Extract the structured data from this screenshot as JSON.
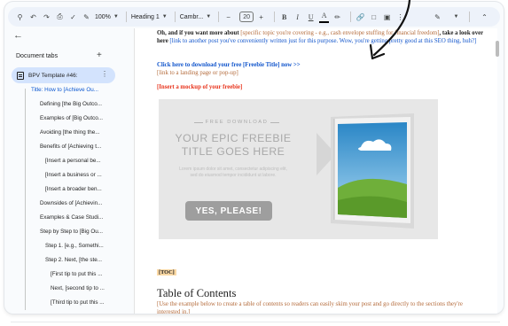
{
  "toolbar": {
    "zoom": "100%",
    "style": "Heading 1",
    "font": "Cambr...",
    "font_size": "20",
    "bold": "B",
    "italic": "I",
    "underline": "U",
    "text_color": "A",
    "minus": "−",
    "plus": "+"
  },
  "sidebar": {
    "title": "Document tabs",
    "add": "+",
    "tab_label": "BPV Template #46:",
    "outline": [
      "Title: How to [Achieve Ou...",
      "Defining [the Big Outco...",
      "Examples of [Big Outco...",
      "Avoiding [the thing the...",
      "Benefits of [Achieving t...",
      "[Insert a personal be...",
      "[Insert a business or ...",
      "[Insert a broader ben...",
      "Downsides of [Achievin...",
      "Examples & Case Studi...",
      "Step by Step to [Big Ou...",
      "Step 1. [e.g., Somethi...",
      "Step 2. Next, [the ste...",
      "[First tip to put this ...",
      "Next, [second tip to ...",
      "[Third tip to put this ..."
    ]
  },
  "doc": {
    "p1_a": "Oh, and if you want more about ",
    "p1_b": "[specific topic you're covering - e.g., cash envelope stuffing for financial freedom]",
    "p1_c": ", take a look over here ",
    "p1_d": "[link to another post you've conveniently written just for this purpose. Wow, you're getting pretty good at this SEO thing, huh?]",
    "cta_link": "Click here to download your free [Freebie Title] now >>",
    "cta_note": "[link to a landing page or pop-up]",
    "mockup_note": "[Insert a mockup of your freebie]",
    "toc_tag": "[TOC]",
    "toc_heading": "Table of Contents",
    "toc_note": "[Use the example below to create a table of contents so readers can easily skim your post and go directly to the sections they're interested in.]"
  },
  "freebie": {
    "kicker": "FREE DOWNLOAD",
    "title": "YOUR EPIC FREEBIE TITLE GOES HERE",
    "body": "Lorem ipsum dolor sit amet, consectetur adipiscing elit, sed do eiusmod tempor incididunt ut labore.",
    "button": "YES, PLEASE!"
  }
}
